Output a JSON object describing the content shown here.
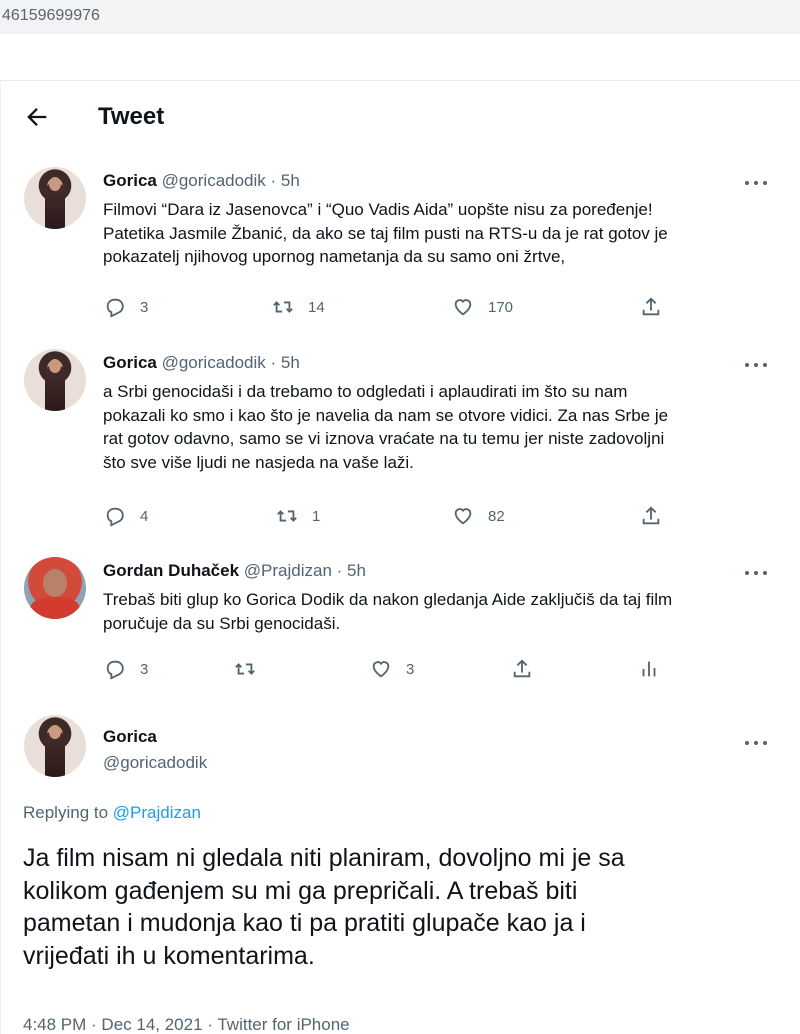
{
  "browser": {
    "url_fragment": "46159699976"
  },
  "header": {
    "title": "Tweet"
  },
  "thread": [
    {
      "author": "Gorica",
      "handle": "@goricadodik",
      "time": "· 5h",
      "lines": [
        "Filmovi “Dara iz Jasenovca” i “Quo Vadis Aida” uopšte nisu za poređenje!",
        "Patetika Jasmile Žbanić, da ako se taj film pusti na RTS-u da je rat gotov je",
        "pokazatelj njihovog upornog nametanja da su samo oni žrtve,"
      ],
      "replies": "3",
      "retweets": "14",
      "likes": "170"
    },
    {
      "author": "Gorica",
      "handle": "@goricadodik",
      "time": "· 5h",
      "lines": [
        "a Srbi genocidaši i da trebamo to odgledati i aplaudirati im što su nam",
        "pokazali ko smo i kao što je navelia da nam se otvore vidici. Za nas Srbe je",
        "rat gotov odavno, samo se vi iznova vraćate na tu temu jer niste zadovoljni",
        "što sve više ljudi ne nasjeda na vaše laži."
      ],
      "replies": "4",
      "retweets": "1",
      "likes": "82"
    },
    {
      "author": "Gordan Duhaček",
      "handle": "@Prajdizan",
      "time": "· 5h",
      "lines": [
        "Trebaš biti glup ko Gorica Dodik da nakon gledanja Aide zaključiš da taj film",
        "poručuje da su Srbi genocidaši."
      ],
      "replies": "3",
      "retweets": "",
      "likes": "3"
    }
  ],
  "main": {
    "author": "Gorica",
    "handle": "@goricadodik",
    "replying_prefix": "Replying to ",
    "replying_to": "@Prajdizan",
    "lines": [
      "Ja film nisam ni gledala niti planiram, dovoljno mi je sa",
      "kolikom gađenjem su mi ga prepričali. A trebaš biti",
      "pametan i mudonja kao ti pa pratiti glupače kao ja i",
      "vrijeđati ih u komentarima."
    ],
    "timestamp": "4:48 PM · Dec 14, 2021 · Twitter for iPhone"
  },
  "icons": [
    "back-arrow-icon",
    "more-icon",
    "reply-icon",
    "retweet-icon",
    "like-icon",
    "share-icon",
    "analytics-icon"
  ],
  "colors": {
    "text": "#0f1419",
    "secondary": "#536471",
    "link": "#1d9bf0",
    "divider": "#eff3f4"
  }
}
